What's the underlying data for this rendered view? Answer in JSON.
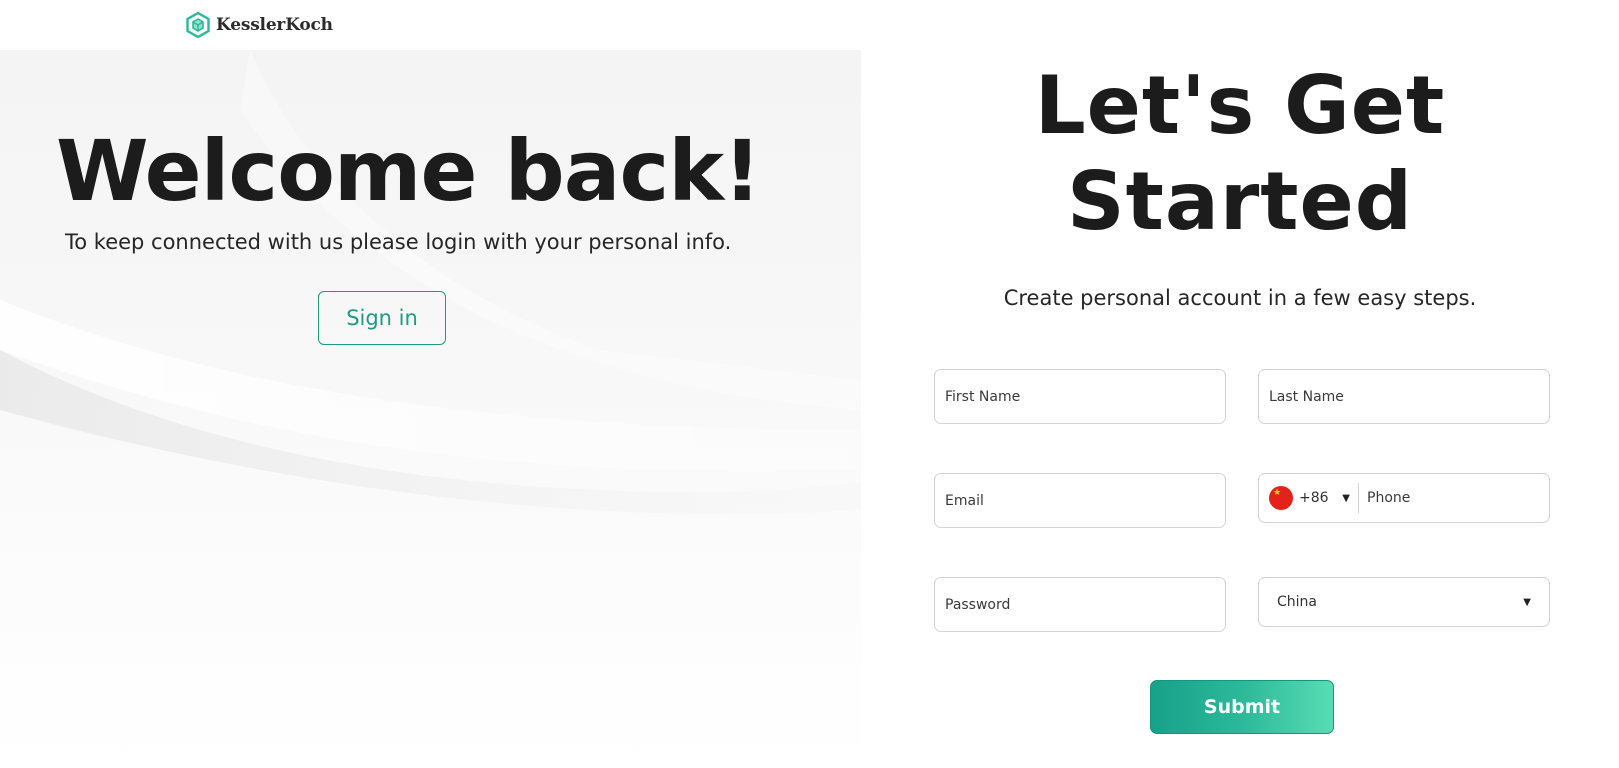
{
  "header": {
    "brand": "KesslerKoch",
    "logo_icon": "hexagon-cube-logo-icon"
  },
  "left": {
    "title": "Welcome back!",
    "subtitle": "To keep connected with us please login with your personal info.",
    "signin_label": "Sign in"
  },
  "right": {
    "title_line1": "Let's Get",
    "title_line2": "Started",
    "subtitle": "Create personal account in a few easy steps.",
    "form": {
      "first_name_placeholder": "First Name",
      "last_name_placeholder": "Last Name",
      "email_placeholder": "Email",
      "phone_placeholder": "Phone",
      "dial_code": "+86",
      "flag_icon": "china-flag-icon",
      "password_placeholder": "Password",
      "country_value": "China",
      "submit_label": "Submit"
    }
  },
  "colors": {
    "accent": "#1f9a83",
    "submit_gradient_start": "#17a18a",
    "submit_gradient_end": "#58dcb4",
    "text": "#1c1c1c"
  }
}
